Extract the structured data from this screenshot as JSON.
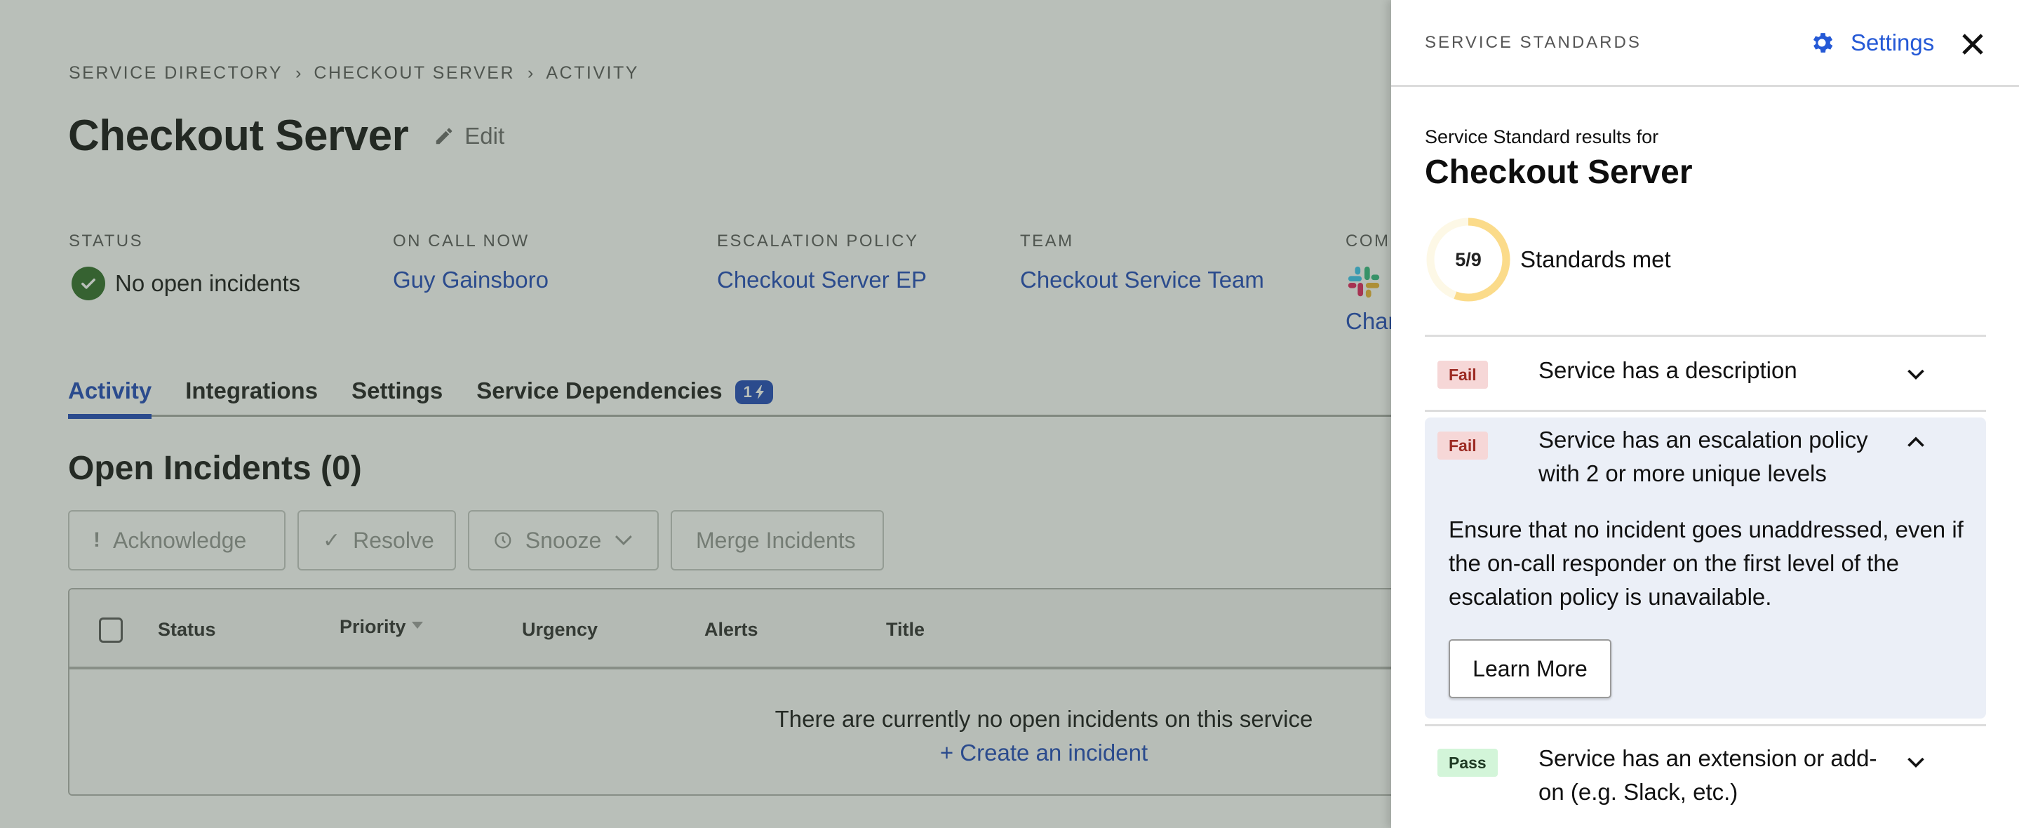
{
  "breadcrumb": [
    "SERVICE DIRECTORY",
    "CHECKOUT SERVER",
    "ACTIVITY"
  ],
  "breadcrumb_separator": "›",
  "page": {
    "title": "Checkout Server",
    "edit_label": "Edit"
  },
  "info": {
    "status": {
      "label": "STATUS",
      "value": "No open incidents"
    },
    "on_call": {
      "label": "ON CALL NOW",
      "value": "Guy Gainsboro"
    },
    "escalation": {
      "label": "ESCALATION POLICY",
      "value": "Checkout Server EP"
    },
    "team": {
      "label": "TEAM",
      "value": "Checkout Service Team"
    },
    "comms": {
      "label": "COMM",
      "value": "Char"
    }
  },
  "tabs": [
    {
      "label": "Activity",
      "active": true
    },
    {
      "label": "Integrations"
    },
    {
      "label": "Settings"
    },
    {
      "label": "Service Dependencies",
      "badge": "1"
    }
  ],
  "open_incidents": {
    "title": "Open Incidents (0)",
    "actions": {
      "acknowledge": "Acknowledge",
      "resolve": "Resolve",
      "snooze": "Snooze",
      "merge": "Merge Incidents"
    },
    "columns": [
      "Status",
      "Priority",
      "Urgency",
      "Alerts",
      "Title"
    ],
    "empty_message": "There are currently no open incidents on this service",
    "create_link": "+ Create an incident"
  },
  "panel": {
    "kicker": "SERVICE STANDARDS",
    "settings_label": "Settings",
    "results_for": "Service Standard results for",
    "service_name": "Checkout Server",
    "score": {
      "met": 5,
      "total": 9,
      "label": "5/9",
      "text": "Standards met"
    },
    "standards": [
      {
        "status": "Fail",
        "title": "Service has a description",
        "expanded": false
      },
      {
        "status": "Fail",
        "title": "Service has an escalation policy with 2 or more unique levels",
        "expanded": true,
        "description": "Ensure that no incident goes unaddressed, even if the on-call responder on the first level of the escalation policy is unavailable.",
        "button": "Learn More"
      },
      {
        "status": "Pass",
        "title": "Service has an extension or add-on (e.g. Slack, etc.)",
        "expanded": false
      }
    ]
  },
  "colors": {
    "link": "#1a45b8",
    "accent_settings": "#2559d6",
    "fail_bg": "#f6d7d7",
    "fail_text": "#9c2b24",
    "pass_bg": "#d3f5d9",
    "ring_fill": "#fbdb8a",
    "ring_track": "#fdf8e6",
    "success": "#2c6a25"
  }
}
